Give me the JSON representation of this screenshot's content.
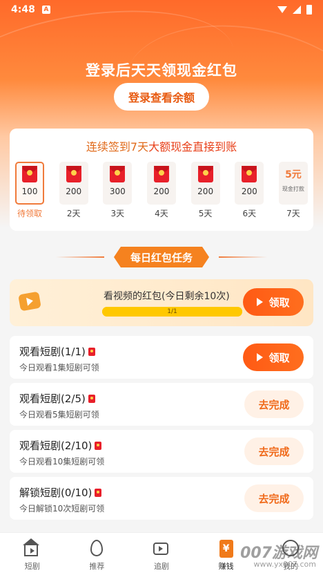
{
  "status_bar": {
    "time": "4:48",
    "notif": "A"
  },
  "hero": {
    "title": "登录后天天领现金红包",
    "login_button": "登录查看余额"
  },
  "signin": {
    "title_prefix": "连续签到7天",
    "title_highlight": "大额现金直接到账",
    "days": [
      {
        "amount": "100",
        "label": "待领取"
      },
      {
        "amount": "200",
        "label": "2天"
      },
      {
        "amount": "300",
        "label": "3天"
      },
      {
        "amount": "200",
        "label": "4天"
      },
      {
        "amount": "200",
        "label": "5天"
      },
      {
        "amount": "200",
        "label": "6天"
      },
      {
        "cash": "5元",
        "cash_sub": "现金打款",
        "label": "7天"
      }
    ]
  },
  "tasks_header": "每日红包任务",
  "video_task": {
    "title": "看视频的红包(今日剩余10次)",
    "progress_text": "1/1",
    "progress": 1.0,
    "button": "领取"
  },
  "tasks": [
    {
      "name": "观看短剧(1/1)",
      "desc": "今日观看1集短剧可领",
      "button": "领取",
      "state": "claim"
    },
    {
      "name": "观看短剧(2/5)",
      "desc": "今日观看5集短剧可领",
      "button": "去完成",
      "state": "go"
    },
    {
      "name": "观看短剧(2/10)",
      "desc": "今日观看10集短剧可领",
      "button": "去完成",
      "state": "go"
    },
    {
      "name": "解锁短剧(0/10)",
      "desc": "今日解锁10次短剧可领",
      "button": "去完成",
      "state": "go"
    }
  ],
  "tabbar": {
    "tabs": [
      {
        "label": "短剧",
        "icon": "home-play-icon"
      },
      {
        "label": "推荐",
        "icon": "fire-icon"
      },
      {
        "label": "追剧",
        "icon": "tv-icon"
      },
      {
        "label": "赚钱",
        "icon": "money-icon",
        "active": true
      },
      {
        "label": "我的",
        "icon": "user-icon"
      }
    ]
  },
  "watermark": {
    "main": "007游戏网",
    "sub": "www.yx007.com"
  },
  "colors": {
    "accent": "#ff5a14",
    "hero": "#ff6a2a"
  }
}
